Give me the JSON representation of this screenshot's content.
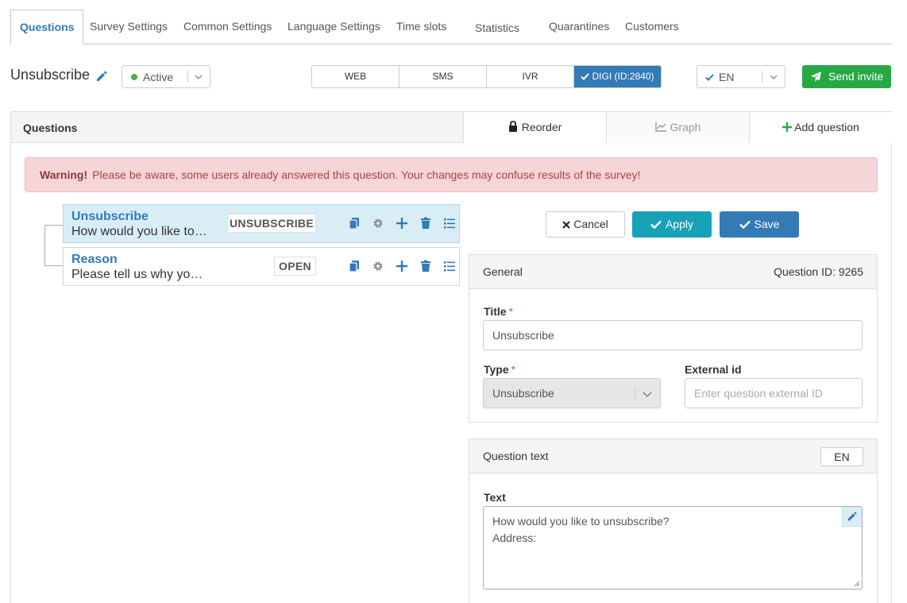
{
  "tabs": [
    {
      "label": "Questions",
      "active": true
    },
    {
      "label": "Survey Settings"
    },
    {
      "label": "Common Settings"
    },
    {
      "label": "Language Settings"
    },
    {
      "label": "Time slots"
    },
    {
      "label": "Statistics"
    },
    {
      "label": "Quarantines"
    },
    {
      "label": "Customers"
    }
  ],
  "survey": {
    "title": "Unsubscribe",
    "status": "Active",
    "channels": [
      "WEB",
      "SMS",
      "IVR",
      "DIGI (ID:2840)"
    ],
    "active_channel": "DIGI (ID:2840)",
    "language": "EN",
    "send_invite": "Send invite"
  },
  "questions_panel": {
    "title": "Questions",
    "reorder": "Reorder",
    "graph": "Graph",
    "add_question": "Add question",
    "warning_strong": "Warning!",
    "warning_text": "Please be aware, some users already answered this question. Your changes may confuse results of the survey!"
  },
  "questions": [
    {
      "title": "Unsubscribe",
      "subtitle": "How would you like to…",
      "type": "UNSUBSCRIBE",
      "selected": true
    },
    {
      "title": "Reason",
      "subtitle": "Please tell us why yo…",
      "type": "OPEN",
      "selected": false
    }
  ],
  "actions": {
    "cancel": "Cancel",
    "apply": "Apply",
    "save": "Save"
  },
  "general": {
    "heading": "General",
    "question_id": "Question ID: 9265",
    "title_label": "Title",
    "title_value": "Unsubscribe",
    "type_label": "Type",
    "type_value": "Unsubscribe",
    "external_label": "External id",
    "external_placeholder": "Enter question external ID"
  },
  "question_text": {
    "heading": "Question text",
    "lang": "EN",
    "text_label": "Text",
    "lines": [
      "How would you like to unsubscribe?",
      "Address:"
    ]
  },
  "colors": {
    "primary": "#337ab7",
    "success": "#28a745",
    "info": "#17a2b8",
    "warning_bg": "#f5d5d8",
    "selected_row": "#d9edf7"
  }
}
